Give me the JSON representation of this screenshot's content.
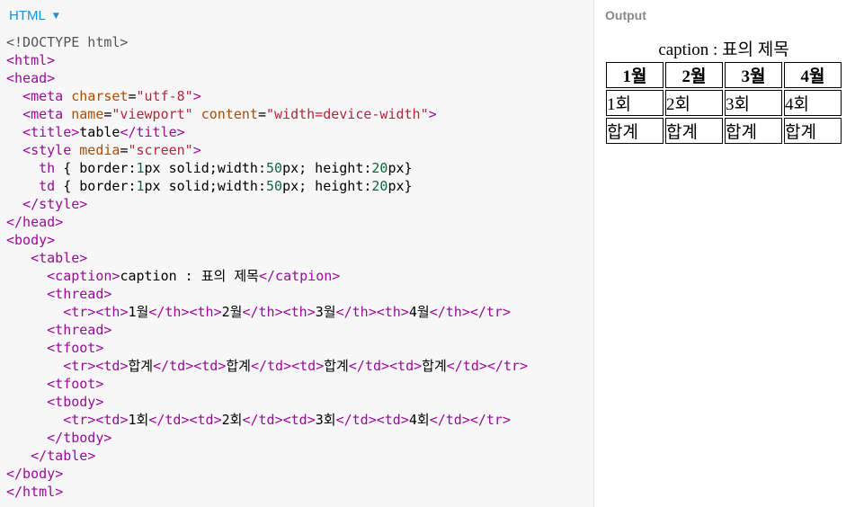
{
  "editor": {
    "language": "HTML",
    "code_lines": [
      "<!DOCTYPE html>",
      "<html>",
      "<head>",
      "  <meta charset=\"utf-8\">",
      "  <meta name=\"viewport\" content=\"width=device-width\">",
      "  <title>table</title>",
      "  <style media=\"screen\">",
      "    th { border:1px solid;width:50px; height:20px}",
      "    td { border:1px solid;width:50px; height:20px}",
      "  </style>",
      "</head>",
      "<body>",
      "   <table>",
      "     <caption>caption : 표의 제목</catpion>",
      "     <thread>",
      "       <tr><th>1월</th><th>2월</th><th>3월</th><th>4월</th></tr>",
      "     <thread>",
      "     <tfoot>",
      "       <tr><td>합계</td><td>합계</td><td>합계</td><td>합계</td></tr>",
      "     <tfoot>",
      "     <tbody>",
      "       <tr><td>1회</td><td>2회</td><td>3회</td><td>4회</td></tr>",
      "     </tbody>",
      "   </table>",
      "</body>",
      "</html>"
    ],
    "active_line": 26
  },
  "output": {
    "title": "Output",
    "table": {
      "caption": "caption : 표의 제목",
      "headers": [
        "1월",
        "2월",
        "3월",
        "4월"
      ],
      "rows": [
        [
          "1회",
          "2회",
          "3회",
          "4회"
        ],
        [
          "합계",
          "합계",
          "합계",
          "합계"
        ]
      ]
    }
  },
  "colors": {
    "tag": "#9a0a9a",
    "attribute": "#b04a00",
    "string": "#b3253a",
    "number": "#116644",
    "keyword": "#221199",
    "language_label": "#1a8fd9",
    "output_label": "#888888",
    "active_line": "#e8f2fd"
  }
}
